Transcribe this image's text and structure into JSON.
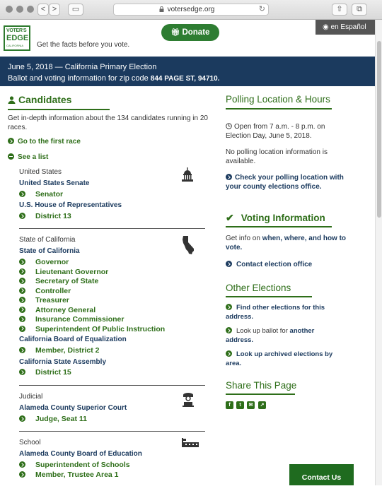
{
  "browser": {
    "url": "votersedge.org",
    "back": "<",
    "forward": ">",
    "reload": "↻"
  },
  "header": {
    "logo_line1": "VOTER'S",
    "logo_line2": "EDGE",
    "logo_line3": "CALIFORNIA",
    "tagline": "Get the facts before you vote.",
    "donate_label": "Donate",
    "lang_label": "en Español"
  },
  "banner": {
    "line1": "June 5, 2018 — California Primary Election",
    "line2_prefix": "Ballot and voting information for zip code ",
    "zip": "844 PAGE ST, 94710."
  },
  "candidates": {
    "title": "Candidates",
    "intro": "Get in-depth information about the 134 candidates running in 20 races.",
    "first_race_link": "Go to the first race",
    "see_list": "See a list",
    "groups": [
      {
        "header": "United States",
        "icon": "capitol-icon",
        "entries": [
          {
            "kind": "body",
            "text": "United States Senate"
          },
          {
            "kind": "office",
            "text": "Senator"
          },
          {
            "kind": "body",
            "text": "U.S. House of Representatives"
          },
          {
            "kind": "office",
            "text": "District 13"
          }
        ]
      },
      {
        "header": "State of California",
        "icon": "california-icon",
        "entries": [
          {
            "kind": "body",
            "text": "State of California"
          },
          {
            "kind": "office",
            "text": "Governor"
          },
          {
            "kind": "office",
            "text": "Lieutenant Governor"
          },
          {
            "kind": "office",
            "text": "Secretary of State"
          },
          {
            "kind": "office",
            "text": "Controller"
          },
          {
            "kind": "office",
            "text": "Treasurer"
          },
          {
            "kind": "office",
            "text": "Attorney General"
          },
          {
            "kind": "office",
            "text": "Insurance Commissioner"
          },
          {
            "kind": "office",
            "text": "Superintendent Of Public Instruction"
          },
          {
            "kind": "body",
            "text": "California Board of Equalization"
          },
          {
            "kind": "office",
            "text": "Member, District 2"
          },
          {
            "kind": "body",
            "text": "California State Assembly"
          },
          {
            "kind": "office",
            "text": "District 15"
          }
        ]
      },
      {
        "header": "Judicial",
        "icon": "judge-icon",
        "entries": [
          {
            "kind": "body",
            "text": "Alameda County Superior Court"
          },
          {
            "kind": "office",
            "text": "Judge, Seat 11"
          }
        ]
      },
      {
        "header": "School",
        "icon": "school-icon",
        "entries": [
          {
            "kind": "body",
            "text": "Alameda County Board of Education"
          },
          {
            "kind": "office",
            "text": "Superintendent of Schools"
          },
          {
            "kind": "office",
            "text": "Member, Trustee Area 1"
          }
        ]
      }
    ]
  },
  "polling": {
    "title": "Polling Location & Hours",
    "hours": "Open from 7 a.m. - 8 p.m. on Election Day, June 5, 2018.",
    "no_info": "No polling location information is available.",
    "check_link": "Check your polling location with your county elections office."
  },
  "voting": {
    "title": "Voting Information",
    "info_prefix": "Get info on ",
    "info_link": "when, where, and how to vote.",
    "contact_link": "Contact election office"
  },
  "other": {
    "title": "Other Elections",
    "find_link": "Find other elections for this address.",
    "lookup_prefix": "Look up ballot for ",
    "lookup_link": "another address.",
    "archived_link": "Look up archived elections by area."
  },
  "share": {
    "title": "Share This Page",
    "icons": [
      "facebook-icon",
      "twitter-icon",
      "email-icon",
      "share-icon"
    ]
  },
  "contact_us_label": "Contact Us"
}
